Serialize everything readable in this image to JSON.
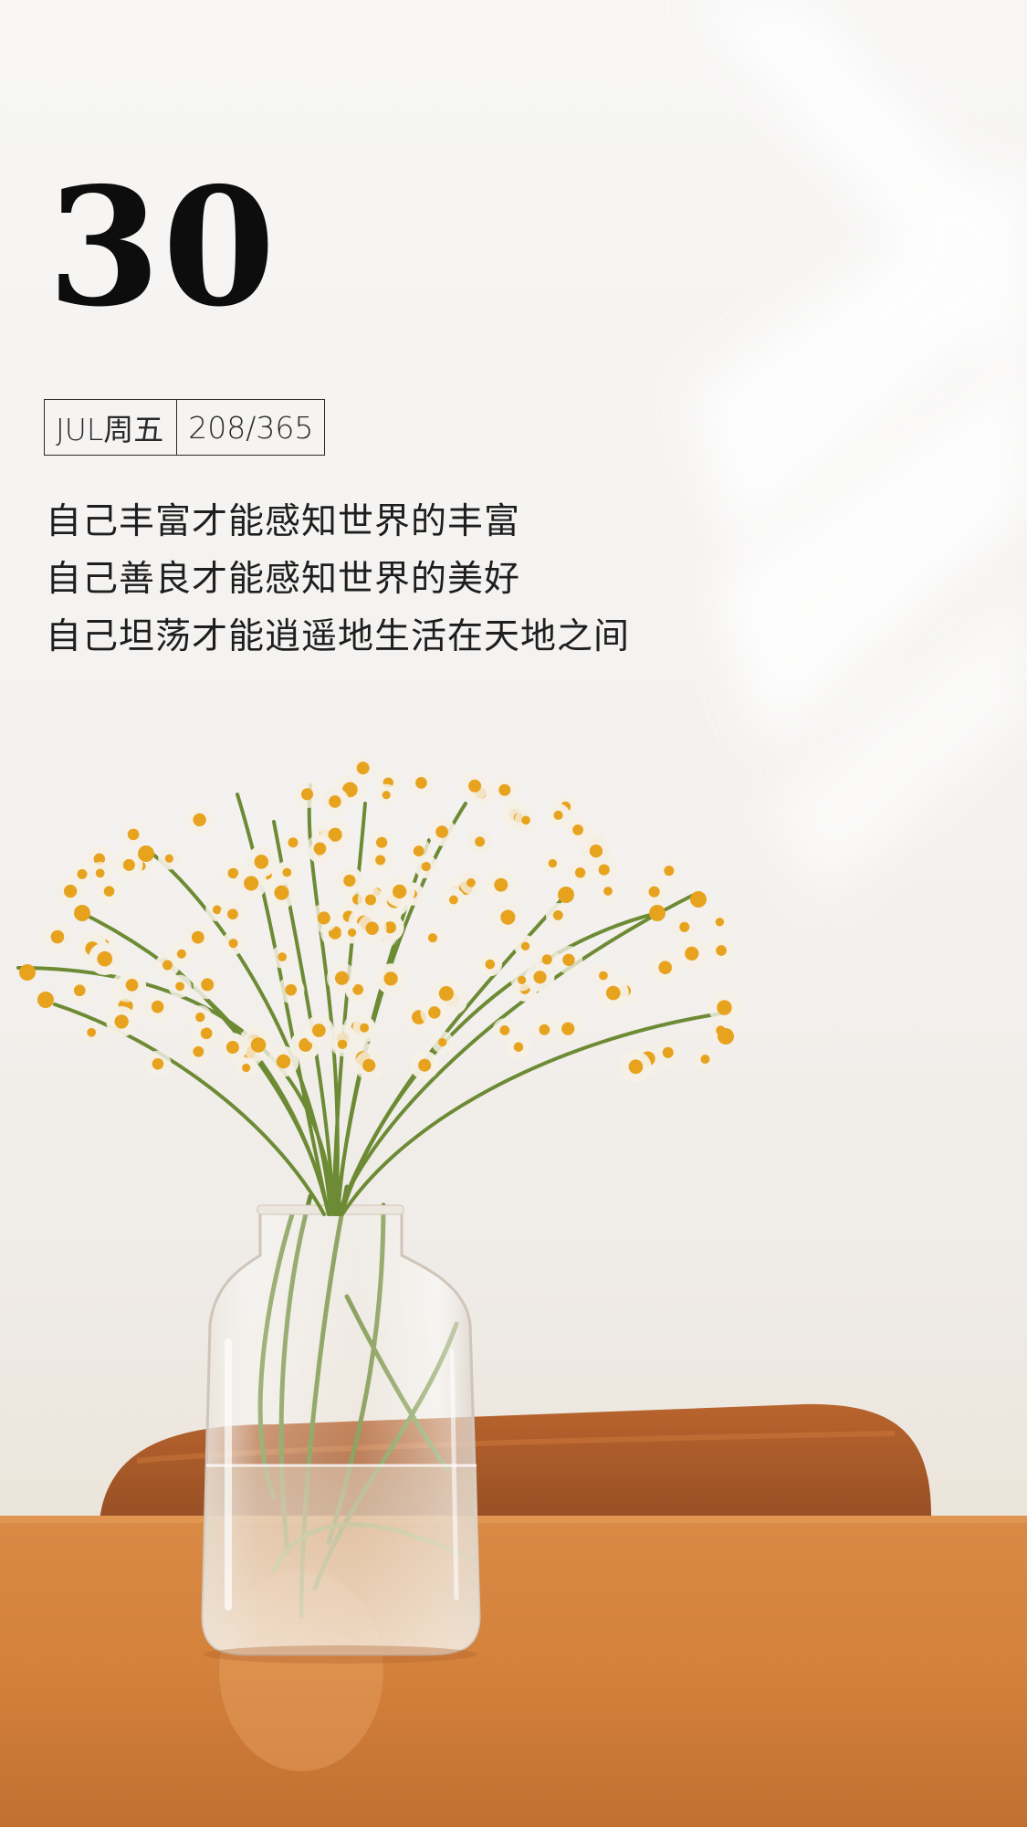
{
  "calendar": {
    "day": "30",
    "month_weekday": "JUL周五",
    "day_of_year": "208/365"
  },
  "quote": {
    "lines": [
      "自己丰富才能感知世界的丰富",
      "自己善良才能感知世界的美好",
      "自己坦荡才能逍遥地生活在天地之间"
    ]
  },
  "colors": {
    "wall": "#f4f2f0",
    "table": "#d98a45",
    "chair": "#a8582a",
    "flower_petal": "#f5f0e6",
    "flower_center": "#e8a31e",
    "stem": "#5d7a2e",
    "text": "#1e1e1e"
  },
  "icons": {
    "vase": "glass-vase-illustration",
    "flowers": "daisy-bouquet-illustration"
  }
}
